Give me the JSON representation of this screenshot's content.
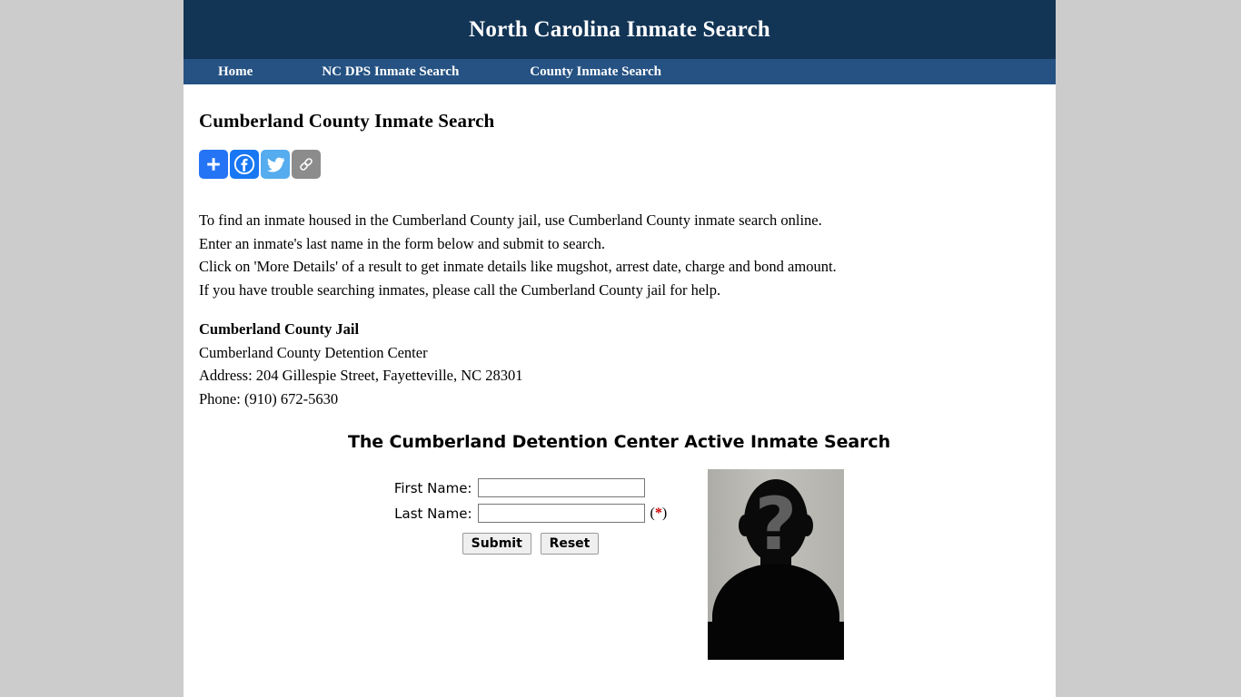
{
  "header": {
    "site_title": "North Carolina Inmate Search"
  },
  "nav": {
    "items": [
      {
        "label": "Home",
        "name": "nav-item-home"
      },
      {
        "label": "NC DPS Inmate Search",
        "name": "nav-item-nc-dps-inmate-search"
      },
      {
        "label": "County Inmate Search",
        "name": "nav-item-county-inmate-search"
      }
    ]
  },
  "main": {
    "page_heading": "Cumberland County Inmate Search",
    "share": {
      "buttons": [
        {
          "icon": "addthis-plus-icon",
          "label": "Share",
          "color": "#2574f5"
        },
        {
          "icon": "facebook-icon",
          "label": "Facebook",
          "color": "#1877f2"
        },
        {
          "icon": "twitter-icon",
          "label": "Twitter",
          "color": "#55acee"
        },
        {
          "icon": "link-icon",
          "label": "Copy Link",
          "color": "#8c8c8c"
        }
      ]
    },
    "intro_lines": [
      "To find an inmate housed in the Cumberland County jail, use Cumberland County inmate search online.",
      "Enter an inmate's last name in the form below and submit to search.",
      "Click on 'More Details' of a result to get inmate details like mugshot, arrest date, charge and bond amount.",
      "If you have trouble searching inmates, please call the Cumberland County jail for help."
    ],
    "jail": {
      "name": "Cumberland County Jail",
      "facility": "Cumberland County Detention Center",
      "address": "Address: 204 Gillespie Street, Fayetteville, NC 28301",
      "phone": "Phone: (910) 672-5630"
    },
    "form": {
      "heading": "The Cumberland Detention Center Active Inmate Search",
      "first_name_label": "First Name:",
      "first_name_value": "",
      "first_name_placeholder": "",
      "last_name_label": "Last Name:",
      "last_name_value": "",
      "last_name_placeholder": "",
      "required_mark": "(*)",
      "required_open": "(",
      "required_star": "*",
      "required_close": ")",
      "submit_label": "Submit",
      "reset_label": "Reset",
      "mugshot_alt": "inmate-placeholder-silhouette"
    }
  },
  "colors": {
    "header_bg": "#123455",
    "nav_bg": "#255283",
    "page_bg": "#cccccc",
    "content_bg": "#ffffff",
    "required_star": "#cc0000"
  }
}
